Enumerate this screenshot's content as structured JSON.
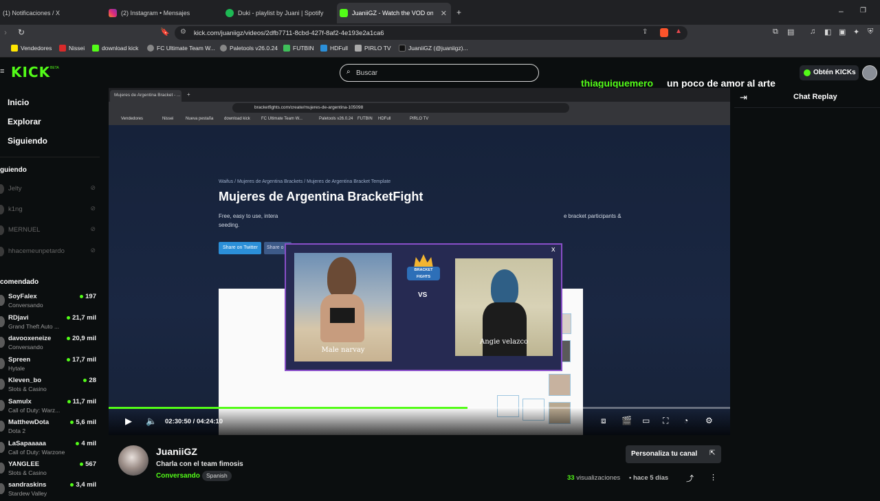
{
  "browser": {
    "tabs": [
      {
        "label": "(1) Notificaciones / X",
        "color": "#1d1d1d"
      },
      {
        "label": "(2) Instagram • Mensajes",
        "color": "#d6249f"
      },
      {
        "label": "Duki - playlist by Juani | Spotify",
        "color": "#1db954"
      },
      {
        "label": "JuaniiGZ - Watch the VOD on Kick",
        "color": "#53fc18"
      }
    ],
    "url": "kick.com/juaniigz/videos/2dfb7711-8cbd-427f-8af2-4e193e2a1ca6",
    "bookmarks": [
      "Vendedores",
      "Nissei",
      "download kick",
      "FC Ultimate Team W...",
      "Paletools v26.0.24",
      "FUTBIN",
      "HDFull",
      "PIRLO TV",
      "JuaniiGZ (@juaniigz)..."
    ]
  },
  "header": {
    "logo": "KICK",
    "logo_badge": "BETA",
    "search_placeholder": "Buscar",
    "get_kicks_label": "Obtén KICKs",
    "chat_ticker_user": "thiaguiquemero",
    "chat_ticker_message": "un poco de amor al arte"
  },
  "sidebar": {
    "nav": [
      "Inicio",
      "Explorar",
      "Siguiendo"
    ],
    "following_title": "guiendo",
    "following": [
      "Jelty",
      "k1ng",
      "MERNUEL",
      "hhacemeunpetardo"
    ],
    "recommended_title": "comendado",
    "recommended": [
      {
        "name": "SoyFalex",
        "category": "Conversando",
        "viewers": "197"
      },
      {
        "name": "RDjavi",
        "category": "Grand Theft Auto ...",
        "viewers": "21,7 mil"
      },
      {
        "name": "davooxeneize",
        "category": "Conversando",
        "viewers": "20,9 mil"
      },
      {
        "name": "Spreen",
        "category": "Hytale",
        "viewers": "17,7 mil"
      },
      {
        "name": "Kleven_bo",
        "category": "Slots & Casino",
        "viewers": "28"
      },
      {
        "name": "Samulx",
        "category": "Call of Duty: Warz...",
        "viewers": "11,7 mil"
      },
      {
        "name": "MatthewDota",
        "category": "Dota 2",
        "viewers": "5,6 mil"
      },
      {
        "name": "LaSapaaaaa",
        "category": "Call of Duty: Warzone",
        "viewers": "4 mil"
      },
      {
        "name": "YANGLEE",
        "category": "Slots & Casino",
        "viewers": "567"
      },
      {
        "name": "sandraskins",
        "category": "Stardew Valley",
        "viewers": "3,4 mil"
      }
    ]
  },
  "video": {
    "inner_tab": "Mujeres de Argentina Bracket - ...",
    "inner_url": "bracketfights.com/create/mujeres-de-argentina-105098",
    "inner_bookmarks": [
      "Vendedores",
      "Nissei",
      "Nueva pestaña",
      "download kick",
      "FC Ultimate Team W...",
      "Paletools v26.0.24",
      "FUTBIN",
      "HDFull",
      "PIRLO TV"
    ],
    "breadcrumb": "Waifus / Mujeres de Argentina Brackets / Mujeres de Argentina Bracket Template",
    "page_heading": "Mujeres de Argentina BracketFight",
    "page_desc_left": "Free, easy to use, intera",
    "page_desc_right": "e bracket participants &",
    "page_desc_line2": "seeding.",
    "share_twitter": "Share on Twitter",
    "share_other": "Share o",
    "modal_close": "x",
    "modal_logo_top": "BRACKET",
    "modal_logo_bottom": "FIGHTS",
    "vs_label": "VS",
    "contestant_left": "Male narvay",
    "contestant_right": "Angie velazco",
    "time_current": "02:30:50",
    "time_separator": "/",
    "time_total": "04:24:10",
    "progress_fraction": 0.577
  },
  "chat": {
    "title": "Chat Replay"
  },
  "channel": {
    "name": "JuaniiGZ",
    "title": "Charla con el team fimosis",
    "category": "Conversando",
    "language": "Spanish",
    "customize_label": "Personaliza tu canal",
    "views_count": "33",
    "views_label": "visualizaciones",
    "age": "hace 5 días"
  },
  "colors": {
    "accent": "#53fc18",
    "background": "#0b0e0f",
    "modal_border": "#8a4fc9"
  }
}
